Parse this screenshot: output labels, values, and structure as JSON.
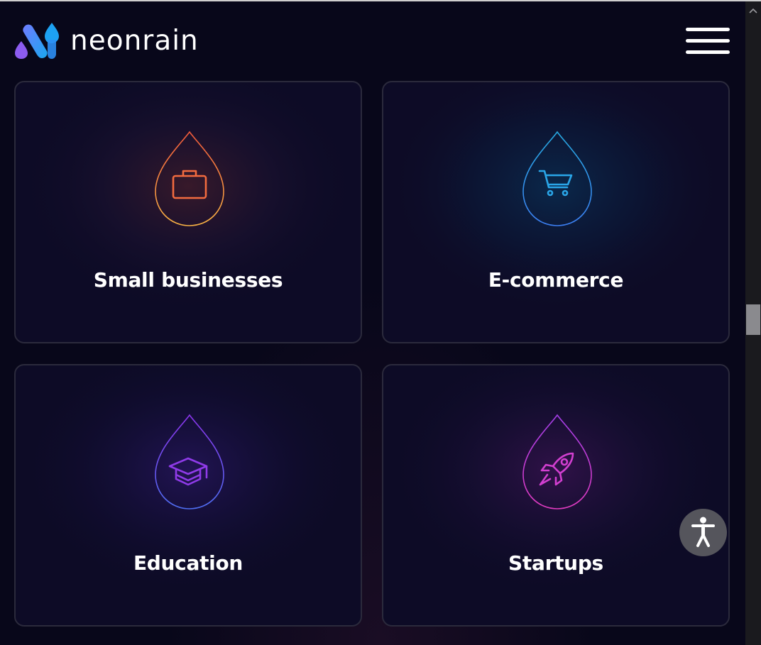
{
  "brand": {
    "name": "neonrain",
    "logo_icon": "neonrain-logo-icon"
  },
  "header": {
    "menu_icon": "hamburger-menu-icon"
  },
  "cards": [
    {
      "id": "small-businesses",
      "label": "Small businesses",
      "icon": "briefcase-icon",
      "color_top": "#f15a3b",
      "color_bottom": "#f7b244"
    },
    {
      "id": "e-commerce",
      "label": "E-commerce",
      "icon": "shopping-cart-icon",
      "color_top": "#27a9e1",
      "color_bottom": "#3c7ff2"
    },
    {
      "id": "education",
      "label": "Education",
      "icon": "graduation-cap-icon",
      "color_top": "#8b34ec",
      "color_bottom": "#4f6ef2"
    },
    {
      "id": "startups",
      "label": "Startups",
      "icon": "rocket-icon",
      "color_top": "#a43ee8",
      "color_bottom": "#e13bc0"
    }
  ],
  "accessibility": {
    "icon": "accessibility-person-icon"
  },
  "colors": {
    "background": "#08071a",
    "card_background": "#0d0b26",
    "card_border": "#2b2a3c",
    "text": "#ffffff",
    "logo_gradient_start": "#7b5cff",
    "logo_gradient_end": "#1da1f2"
  }
}
